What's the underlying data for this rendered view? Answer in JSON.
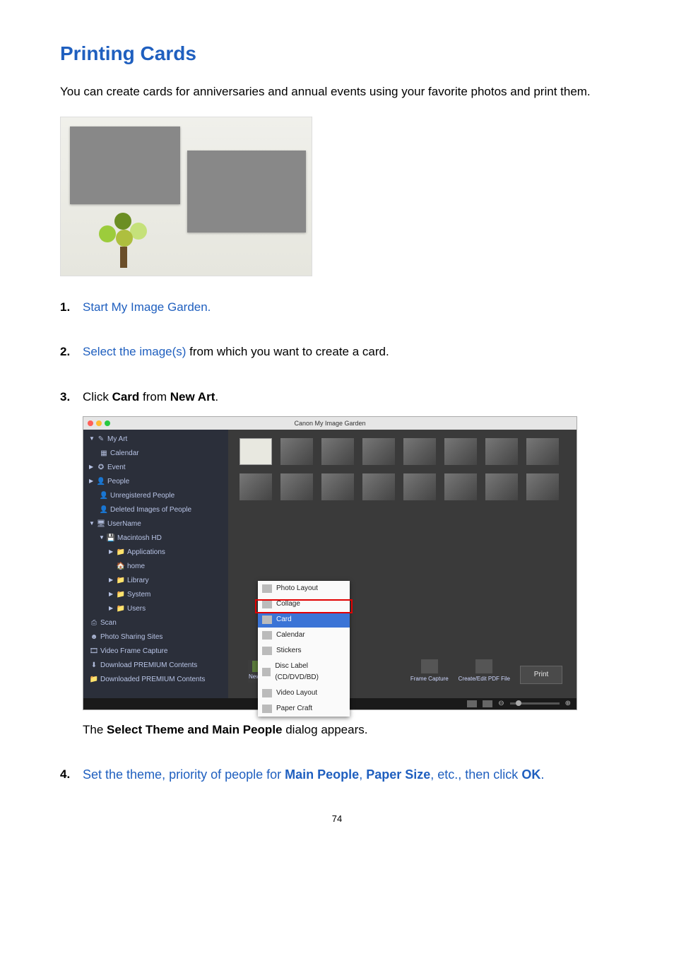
{
  "title": "Printing Cards",
  "intro": "You can create cards for anniversaries and annual events using your favorite photos and print them.",
  "steps": {
    "s1": {
      "link": "Start My Image Garden."
    },
    "s2": {
      "link": "Select the image(s)",
      "rest": " from which you want to create a card."
    },
    "s3": {
      "pre": "Click ",
      "b1": "Card",
      "mid": " from ",
      "b2": "New Art",
      "post": ".",
      "after": "The ",
      "after_b": "Select Theme and Main People",
      "after_post": " dialog appears."
    },
    "s4": {
      "a": "Set the theme, priority of people for ",
      "b1": "Main People",
      "c": ", ",
      "b2": "Paper Size",
      "d": ", etc., then click ",
      "b3": "OK",
      "e": "."
    }
  },
  "screenshot": {
    "title": "Canon My Image Garden",
    "sidebar": {
      "myart": "My Art",
      "calendar": "Calendar",
      "event": "Event",
      "people": "People",
      "unreg": "Unregistered People",
      "deleted": "Deleted Images of People",
      "username": "UserName",
      "mac": "Macintosh HD",
      "apps": "Applications",
      "home": "home",
      "library": "Library",
      "system": "System",
      "users": "Users",
      "scan": "Scan",
      "sharing": "Photo Sharing Sites",
      "vfc": "Video Frame Capture",
      "dlpc": "Download PREMIUM Contents",
      "dldpc": "Downloaded PREMIUM Contents"
    },
    "menu": {
      "photolayout": "Photo Layout",
      "collage": "Collage",
      "card": "Card",
      "cal": "Calendar",
      "stickers": "Stickers",
      "disc": "Disc Label (CD/DVD/BD)",
      "video": "Video Layout",
      "paper": "Paper Craft"
    },
    "newart": "New Art",
    "frame": "Frame Capture",
    "pdf": "Create/Edit PDF File",
    "print": "Print"
  },
  "page_number": "74"
}
